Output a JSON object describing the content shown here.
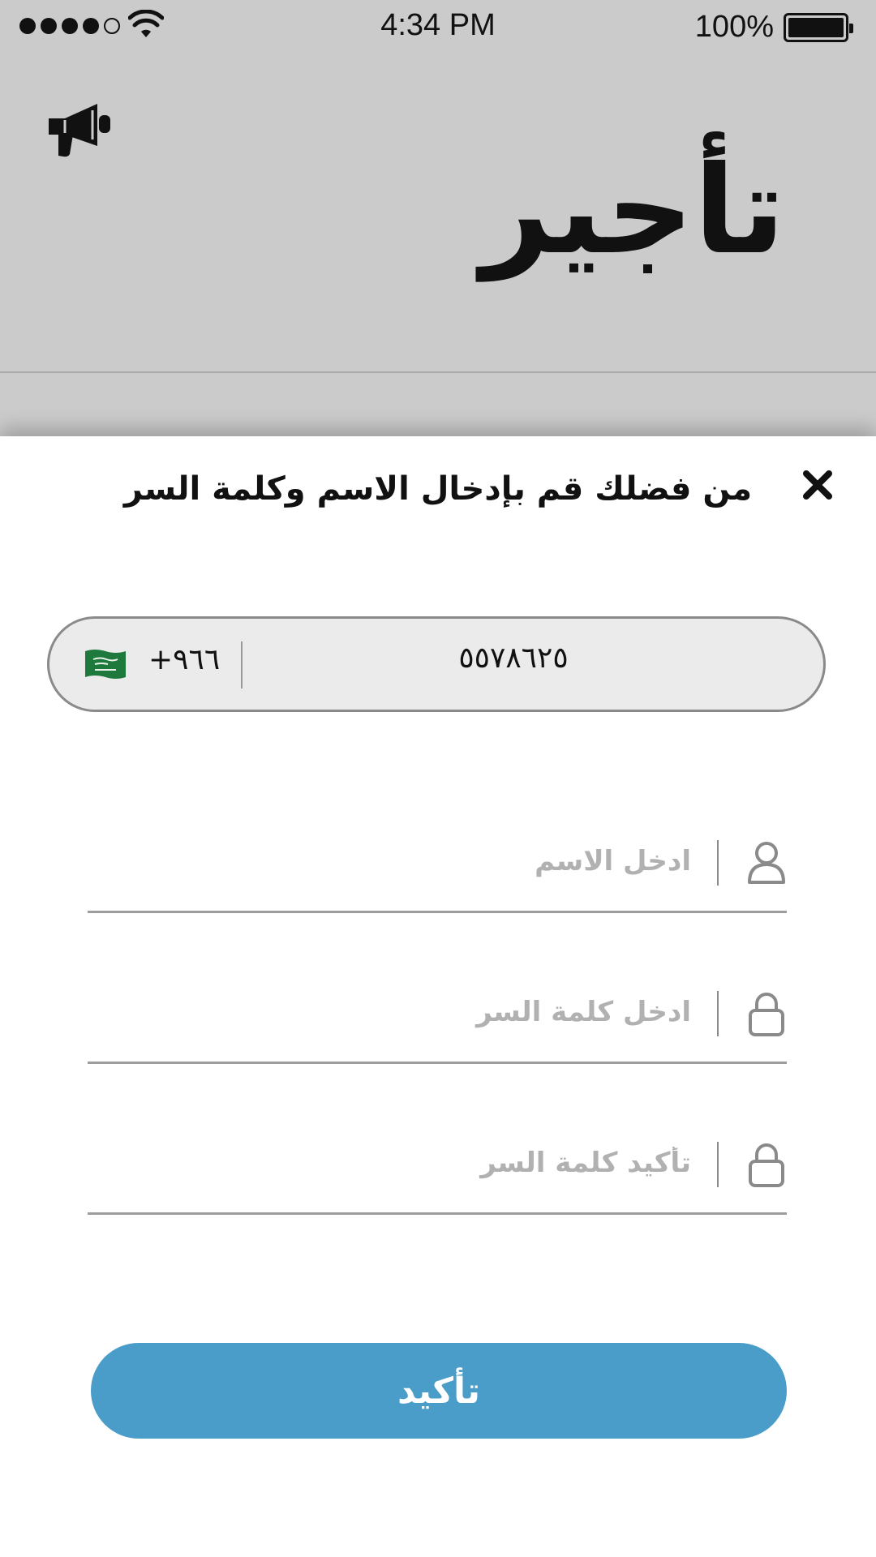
{
  "status_bar": {
    "time": "4:34 PM",
    "battery_percent": "100%",
    "signal_bars_filled": 4,
    "signal_bars_total": 5
  },
  "header": {
    "title": "تأجير",
    "left_icon": "megaphone-icon"
  },
  "sheet": {
    "title": "من فضلك قم بإدخال الاسم وكلمة السر",
    "close_icon": "close-icon",
    "phone": {
      "flag_icon": "saudi-flag-icon",
      "country_code": "+٩٦٦",
      "number": "٥٥٧٨٦٢٥"
    },
    "fields": [
      {
        "placeholder": "ادخل الاسم",
        "icon": "user-icon",
        "value": ""
      },
      {
        "placeholder": "ادخل كلمة السر",
        "icon": "lock-icon",
        "value": ""
      },
      {
        "placeholder": "تأكيد كلمة السر",
        "icon": "lock-icon",
        "value": ""
      }
    ],
    "confirm_label": "تأكيد"
  },
  "colors": {
    "header_background": "#cbcbcb",
    "accent_button": "#4a9cc9",
    "phone_field_background": "#ebebeb",
    "placeholder": "#b1b1b1"
  }
}
